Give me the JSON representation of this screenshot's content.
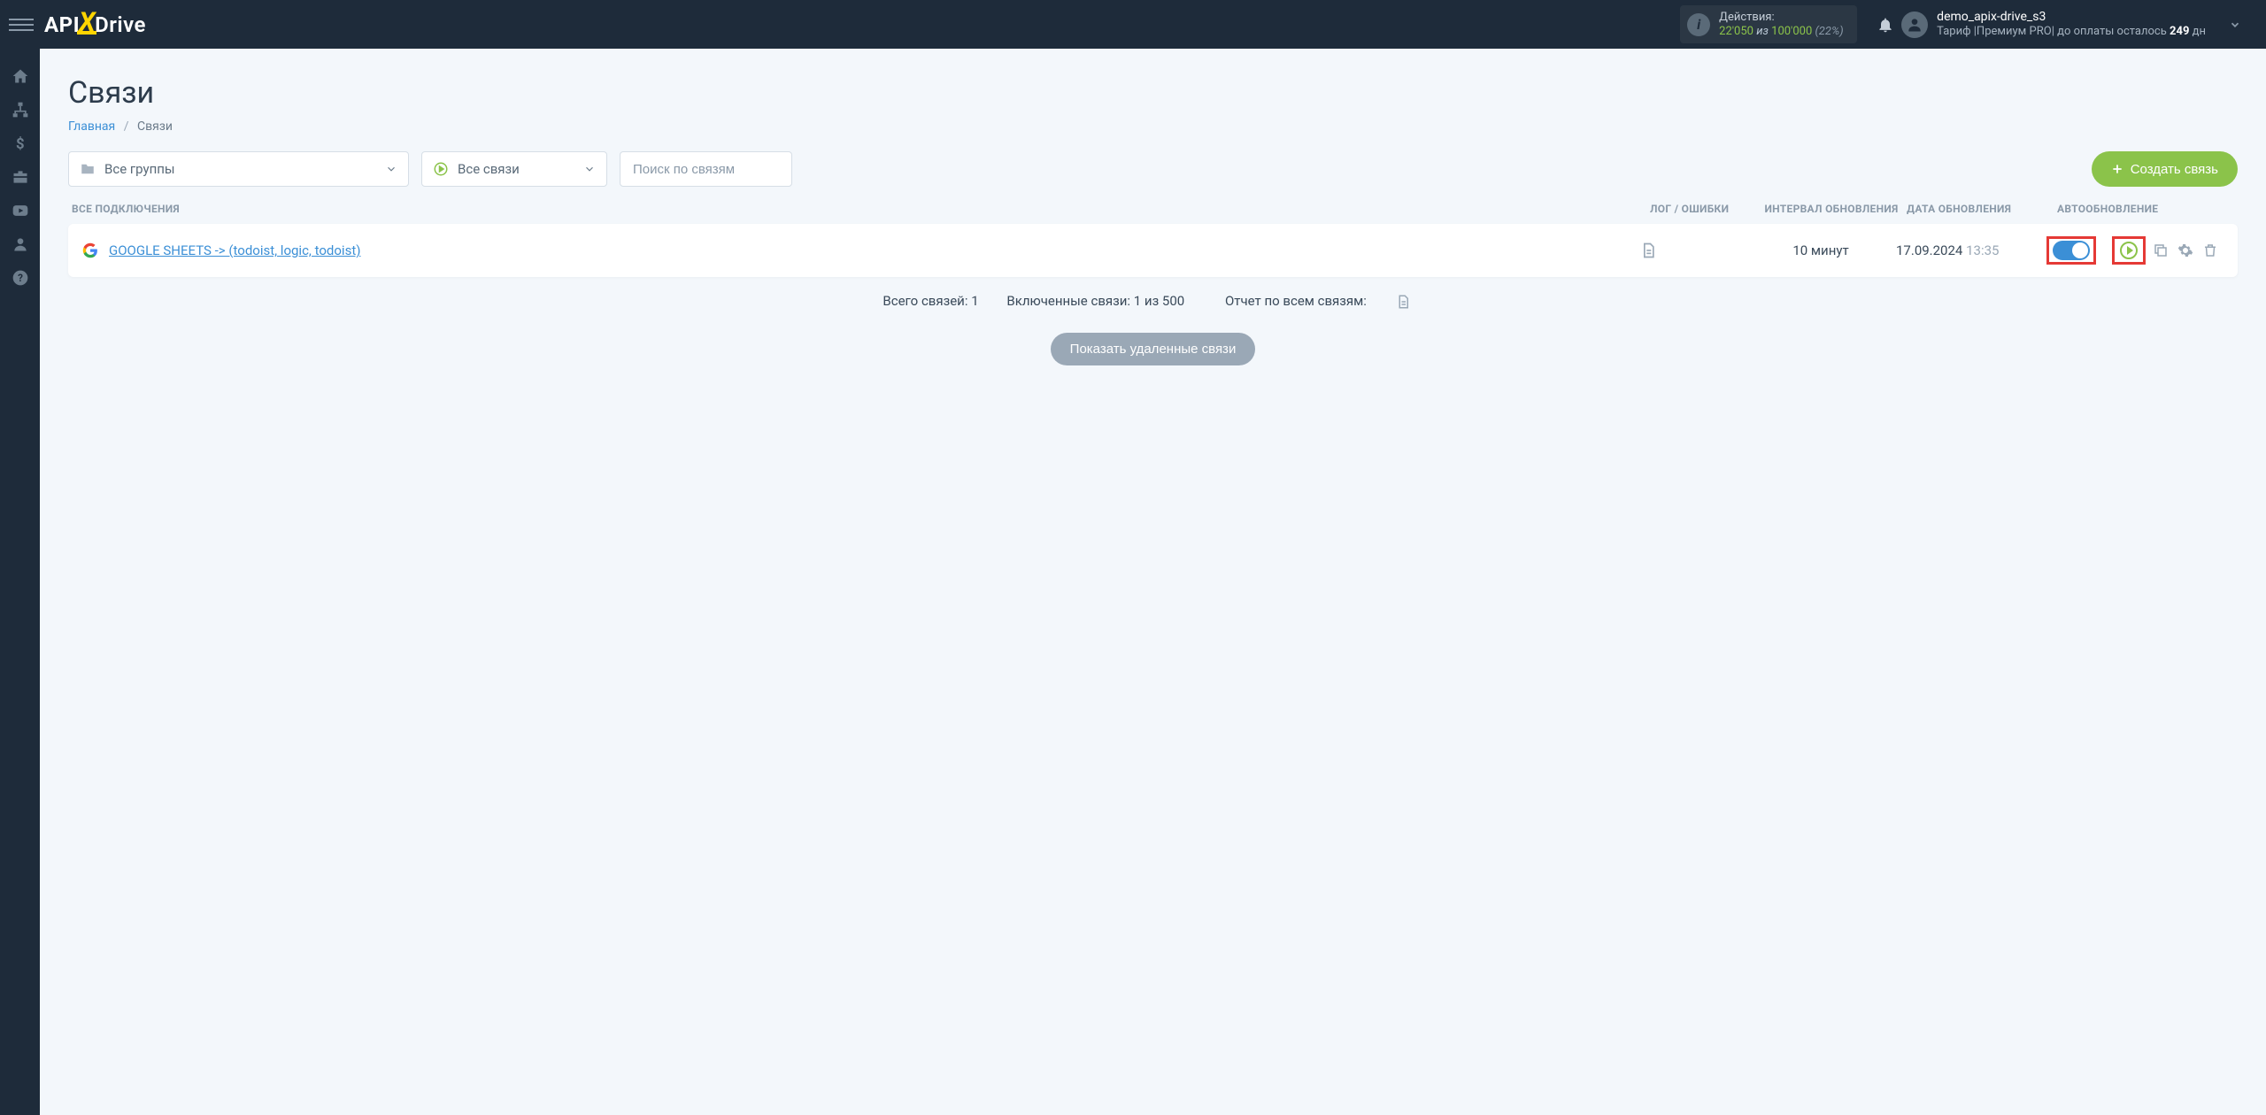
{
  "header": {
    "actions_label": "Действия:",
    "actions_used": "22'050",
    "actions_iz": "из",
    "actions_total": "100'000",
    "actions_pct": "(22%)",
    "user_name": "demo_apix-drive_s3",
    "tariff_prefix": "Тариф |Премиум PRO| до оплаты осталось",
    "tariff_days": "249",
    "tariff_suffix": "дн"
  },
  "page": {
    "title": "Связи",
    "bc_main": "Главная",
    "bc_current": "Связи"
  },
  "filters": {
    "groups_label": "Все группы",
    "status_label": "Все связи",
    "search_placeholder": "Поиск по связям",
    "create_label": "Создать связь"
  },
  "columns": {
    "conn": "ВСЕ ПОДКЛЮЧЕНИЯ",
    "log": "ЛОГ / ОШИБКИ",
    "interval": "ИНТЕРВАЛ ОБНОВЛЕНИЯ",
    "date": "ДАТА ОБНОВЛЕНИЯ",
    "auto": "АВТООБНОВЛЕНИЕ"
  },
  "row": {
    "name": "GOOGLE SHEETS -> (todoist, logic, todoist)",
    "interval": "10 минут",
    "date": "17.09.2024",
    "time": "13:35"
  },
  "summary": {
    "total": "Всего связей: 1",
    "enabled": "Включенные связи: 1 из 500",
    "report": "Отчет по всем связям:"
  },
  "show_deleted": "Показать удаленные связи"
}
